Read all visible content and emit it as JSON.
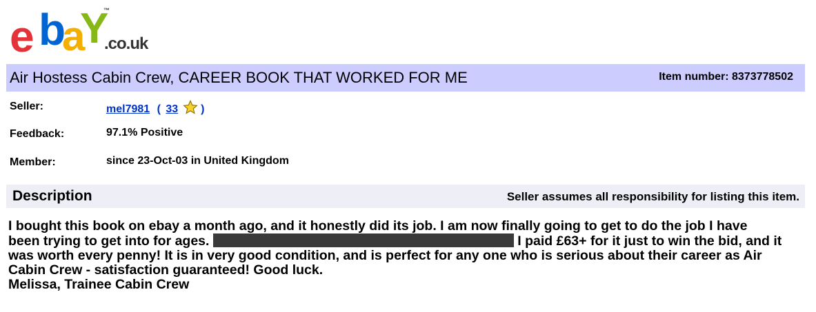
{
  "logo": {
    "letters": [
      "e",
      "b",
      "a",
      "Y"
    ],
    "trademark": "™",
    "domain": ".co.uk",
    "colors": {
      "e": "#e53238",
      "b": "#0064d2",
      "a": "#f5af02",
      "y": "#86b817"
    }
  },
  "listing": {
    "title": "Air Hostess Cabin Crew, CAREER BOOK THAT WORKED FOR ME",
    "item_number": "Item number: 8373778502"
  },
  "seller": {
    "seller_label": "Seller:",
    "username": "mel7981",
    "rating_open": "(",
    "rating": "33",
    "rating_close": ")",
    "feedback_label": "Feedback:",
    "feedback_value": "97.1% Positive",
    "member_label": "Member:",
    "member_value": "since 23-Oct-03 in United Kingdom",
    "star_icon": "yellow-star-icon"
  },
  "description": {
    "heading": "Description",
    "responsibility": "Seller assumes all responsibility for listing this item.",
    "line1": "I bought this book on ebay a month ago, and it honestly did its job. I am now finally going to get to do the job I have",
    "line2_before": "been trying to get into for ages. ",
    "line2_after": " I paid £63+ for it just to win the bid, and it",
    "line3": "was worth every penny! It is in very good condition, and is perfect for any one who is serious about their career as Air",
    "line4": "Cabin Crew - satisfaction guaranteed! Good luck.",
    "line5": "Melissa, Trainee Cabin Crew"
  },
  "colors": {
    "title_bar": "#ccccff",
    "description_bar": "#eeeef6",
    "link": "#0033cc",
    "redaction": "#3a3a3a"
  }
}
